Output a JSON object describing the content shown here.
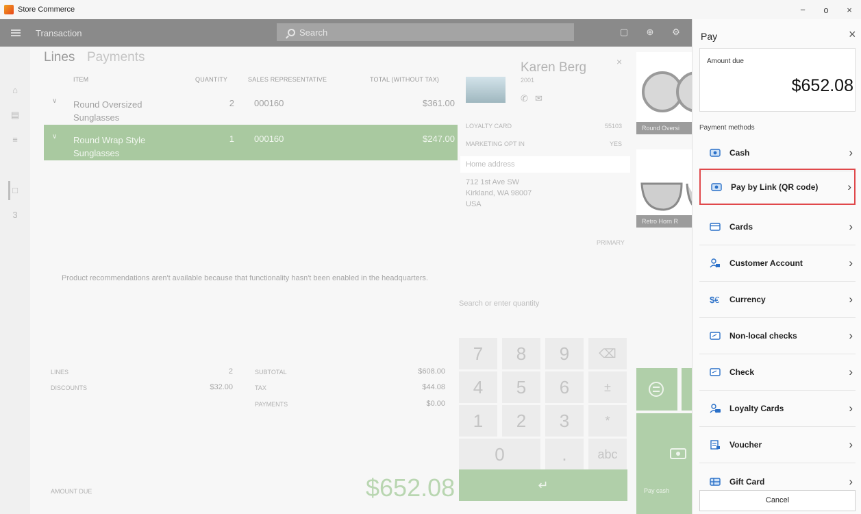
{
  "window": {
    "title": "Store Commerce",
    "minimize": "−",
    "restore": "o",
    "close": "×"
  },
  "topbar": {
    "title": "Transaction",
    "search_placeholder": "Search"
  },
  "left_nav": {
    "count_badge": "3"
  },
  "tabs": {
    "lines": "Lines",
    "payments": "Payments"
  },
  "columns": {
    "item": "ITEM",
    "quantity": "QUANTITY",
    "sales_rep": "SALES REPRESENTATIVE",
    "total": "TOTAL (WITHOUT TAX)"
  },
  "lines": [
    {
      "name_1": "Round Oversized",
      "name_2": "Sunglasses",
      "quantity": "2",
      "sales_rep": "000160",
      "total": "$361.00",
      "selected": false
    },
    {
      "name_1": "Round Wrap Style",
      "name_2": "Sunglasses",
      "quantity": "1",
      "sales_rep": "000160",
      "total": "$247.00",
      "selected": true
    }
  ],
  "recommendation_note": "Product recommendations aren't available because that functionality hasn't been enabled in the headquarters.",
  "totals": {
    "lines_label": "LINES",
    "lines_value": "2",
    "discounts_label": "DISCOUNTS",
    "discounts_value": "$32.00",
    "subtotal_label": "SUBTOTAL",
    "subtotal_value": "$608.00",
    "tax_label": "TAX",
    "tax_value": "$44.08",
    "payments_label": "PAYMENTS",
    "payments_value": "$0.00",
    "amount_due_label": "AMOUNT DUE",
    "amount_due_value": "$652.08"
  },
  "customer": {
    "name": "Karen Berg",
    "id": "2001",
    "loyalty_label": "LOYALTY CARD",
    "loyalty_value": "55103",
    "marketing_label": "MARKETING OPT IN",
    "marketing_value": "YES",
    "home_address_label": "Home address",
    "address_line1": "712 1st Ave SW",
    "address_line2": "Kirkland, WA 98007",
    "address_line3": "USA",
    "primary": "PRIMARY"
  },
  "numpad": {
    "search_placeholder": "Search or enter quantity",
    "keys": [
      "7",
      "8",
      "9",
      "⌫",
      "4",
      "5",
      "6",
      "±",
      "1",
      "2",
      "3",
      "*",
      "0",
      ".",
      "abc"
    ],
    "enter": "↵"
  },
  "products": [
    {
      "label": "Round Oversi"
    },
    {
      "label": "Retro Horn R"
    }
  ],
  "quick_actions": {
    "pay_cash": "Pay cash"
  },
  "pay_panel": {
    "title": "Pay",
    "close": "×",
    "amount_due_label": "Amount due",
    "amount_due_value": "$652.08",
    "payment_methods_label": "Payment methods",
    "methods": [
      {
        "label": "Cash",
        "icon": "cash-icon"
      },
      {
        "label": "Pay by Link (QR code)",
        "icon": "cash-icon",
        "highlighted": true
      },
      {
        "label": "Cards",
        "icon": "card-icon"
      },
      {
        "label": "Customer Account",
        "icon": "customer-account-icon"
      },
      {
        "label": "Currency",
        "icon": "currency-icon"
      },
      {
        "label": "Non-local checks",
        "icon": "check-icon"
      },
      {
        "label": "Check",
        "icon": "check-icon"
      },
      {
        "label": "Loyalty Cards",
        "icon": "loyalty-icon"
      },
      {
        "label": "Voucher",
        "icon": "voucher-icon"
      },
      {
        "label": "Gift Card",
        "icon": "gift-card-icon"
      }
    ],
    "chevron": "›",
    "cancel": "Cancel"
  },
  "colors": {
    "accent_green": "#a9c9a0",
    "icon_blue": "#2a70c8",
    "highlight_red": "#e0484b"
  }
}
